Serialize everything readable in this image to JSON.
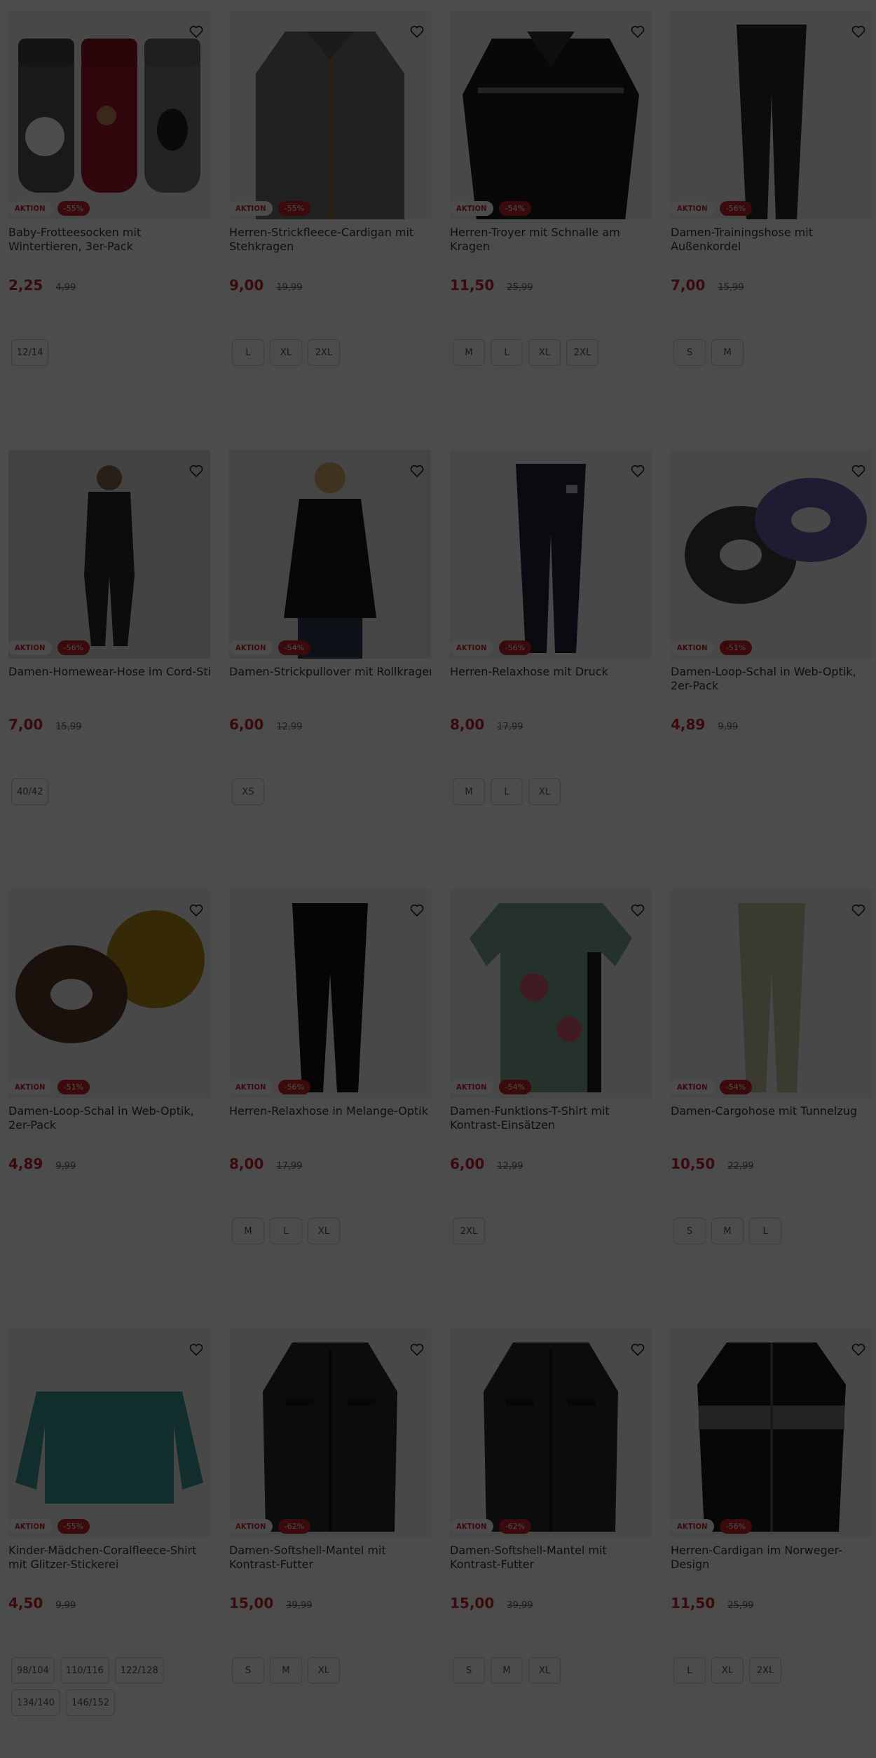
{
  "colors": {
    "accent": "#c3232e",
    "overlay": "rgba(0,0,0,0.7)"
  },
  "products": [
    {
      "title": "Baby-Frotteesocken mit Wintertieren, 3er-Pack",
      "badge": "AKTION",
      "discount": "-55%",
      "price": "2,25",
      "old_price": "4,99",
      "sizes": [
        "12/14"
      ],
      "image": "socks"
    },
    {
      "title": "Herren-Strickfleece-Cardigan mit Stehkragen",
      "badge": "AKTION",
      "discount": "-55%",
      "price": "9,00",
      "old_price": "19,99",
      "sizes": [
        "L",
        "XL",
        "2XL"
      ],
      "image": "cardigan"
    },
    {
      "title": "Herren-Troyer mit Schnalle am Kragen",
      "badge": "AKTION",
      "discount": "-54%",
      "price": "11,50",
      "old_price": "25,99",
      "sizes": [
        "M",
        "L",
        "XL",
        "2XL"
      ],
      "image": "sweater"
    },
    {
      "title": "Damen-Trainingshose mit Außenkordel",
      "badge": "AKTION",
      "discount": "-56%",
      "price": "7,00",
      "old_price": "15,99",
      "sizes": [
        "S",
        "M"
      ],
      "image": "pants-dark"
    },
    {
      "title": "Damen-Homewear-Hose im Cord-Stil",
      "badge": "AKTION",
      "discount": "-56%",
      "price": "7,00",
      "old_price": "15,99",
      "sizes": [
        "40/42"
      ],
      "image": "model-standing"
    },
    {
      "title": "Damen-Strickpullover mit Rollkragen",
      "badge": "AKTION",
      "discount": "-54%",
      "price": "6,00",
      "old_price": "12,99",
      "sizes": [
        "XS"
      ],
      "image": "model-turtleneck"
    },
    {
      "title": "Herren-Relaxhose mit Druck",
      "badge": "AKTION",
      "discount": "-56%",
      "price": "8,00",
      "old_price": "17,99",
      "sizes": [
        "M",
        "L",
        "XL"
      ],
      "image": "pants-navy"
    },
    {
      "title": "Damen-Loop-Schal in Web-Optik, 2er-Pack",
      "badge": "AKTION",
      "discount": "-51%",
      "price": "4,89",
      "old_price": "9,99",
      "sizes": [],
      "image": "scarf-purple"
    },
    {
      "title": "Damen-Loop-Schal in Web-Optik, 2er-Pack",
      "badge": "AKTION",
      "discount": "-51%",
      "price": "4,89",
      "old_price": "9,99",
      "sizes": [],
      "image": "scarf-mustard"
    },
    {
      "title": "Herren-Relaxhose in Melange-Optik",
      "badge": "AKTION",
      "discount": "-56%",
      "price": "8,00",
      "old_price": "17,99",
      "sizes": [
        "M",
        "L",
        "XL"
      ],
      "image": "pants-black"
    },
    {
      "title": "Damen-Funktions-T-Shirt mit Kontrast-Einsätzen",
      "badge": "AKTION",
      "discount": "-54%",
      "price": "6,00",
      "old_price": "12,99",
      "sizes": [
        "2XL"
      ],
      "image": "tshirt"
    },
    {
      "title": "Damen-Cargohose mit Tunnelzug",
      "badge": "AKTION",
      "discount": "-54%",
      "price": "10,50",
      "old_price": "22,99",
      "sizes": [
        "S",
        "M",
        "L"
      ],
      "image": "pants-beige"
    },
    {
      "title": "Kinder-Mädchen-Coralfleece-Shirt mit Glitzer-Stickerei",
      "badge": "AKTION",
      "discount": "-55%",
      "price": "4,50",
      "old_price": "9,99",
      "sizes": [
        "98/104",
        "110/116",
        "122/128",
        "134/140",
        "146/152"
      ],
      "image": "fleece-teal"
    },
    {
      "title": "Damen-Softshell-Mantel mit Kontrast-Futter",
      "badge": "AKTION",
      "discount": "-62%",
      "price": "15,00",
      "old_price": "39,99",
      "sizes": [
        "S",
        "M",
        "XL"
      ],
      "image": "coat"
    },
    {
      "title": "Damen-Softshell-Mantel mit Kontrast-Futter",
      "badge": "AKTION",
      "discount": "-62%",
      "price": "15,00",
      "old_price": "39,99",
      "sizes": [
        "S",
        "M",
        "XL"
      ],
      "image": "coat"
    },
    {
      "title": "Herren-Cardigan im Norweger-Design",
      "badge": "AKTION",
      "discount": "-56%",
      "price": "11,50",
      "old_price": "25,99",
      "sizes": [
        "L",
        "XL",
        "2XL"
      ],
      "image": "norweger"
    }
  ]
}
